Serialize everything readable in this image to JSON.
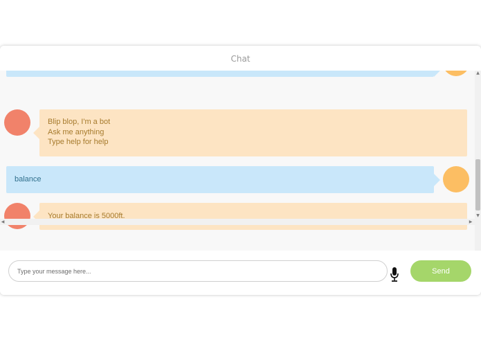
{
  "header": {
    "title": "Chat"
  },
  "messages": [
    {
      "sender": "user",
      "lines": []
    },
    {
      "sender": "bot",
      "lines": [
        "Blip blop, I'm a bot",
        "Ask me anything",
        "Type help for help"
      ]
    },
    {
      "sender": "user",
      "lines": [
        "balance"
      ]
    },
    {
      "sender": "bot",
      "lines": [
        "Your balance is 5000ft."
      ]
    }
  ],
  "composer": {
    "placeholder": "Type your message here...",
    "send_label": "Send"
  },
  "colors": {
    "bot_bubble": "#fde4c3",
    "bot_text": "#a67a2c",
    "bot_avatar": "#f1826a",
    "user_bubble": "#c9e7fa",
    "user_text": "#2f6f8c",
    "user_avatar": "#fcbe63",
    "send_button": "#a5d66a"
  },
  "icons": [
    "microphone-icon"
  ]
}
